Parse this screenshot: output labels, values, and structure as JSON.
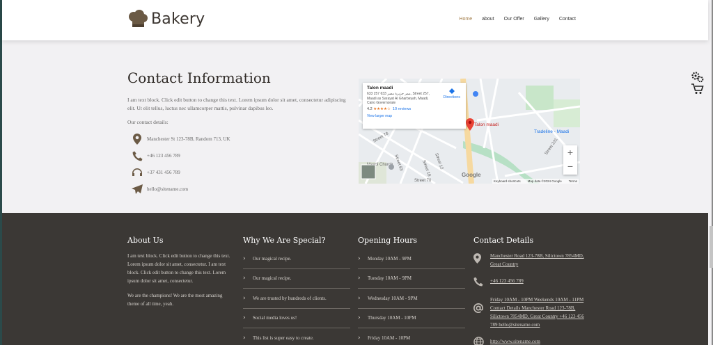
{
  "header": {
    "logo_text": "Bakery",
    "nav": [
      {
        "label": "Home",
        "active": true
      },
      {
        "label": "about",
        "active": false
      },
      {
        "label": "Our Offer",
        "active": false
      },
      {
        "label": "Gallery",
        "active": false
      },
      {
        "label": "Contact",
        "active": false
      }
    ]
  },
  "contact": {
    "title": "Contact Information",
    "intro": "I am text block. Click edit button to change this text. Lorem ipsum dolor sit amet, consectetur adipiscing elit. Ut elit tellus, luctus nec ullamcorper mattis, pulvinar dapibus leo.",
    "details_label": "Our contact details:",
    "details": [
      {
        "icon": "map-marker-icon",
        "text": "Manchester St 123-78B, Random 713, UK"
      },
      {
        "icon": "phone-icon",
        "text": "+46 123 456 789"
      },
      {
        "icon": "headphones-icon",
        "text": "+37 431 456 789"
      },
      {
        "icon": "paper-plane-icon",
        "text": "hello@sitename.com"
      }
    ]
  },
  "map": {
    "place_name": "Talon maadi",
    "address": "633 257 633 ممر جزيرة مصر, Street 257, Maadi as Sarayat Al Gharbeyah, Maadi, Cairo Governorate",
    "rating": "4.2",
    "stars": "★★★★☆",
    "reviews": "10 reviews",
    "directions": "Directions",
    "larger_map": "View larger map",
    "pin_label": "Talon maadi",
    "poi_label": "Tradeline - Maadi",
    "street_labels": [
      "Street 78",
      "Street 83",
      "Street 18",
      "Street 12",
      "Street 70",
      "Street 231"
    ],
    "church_label": "Maadi Church",
    "google": "Google",
    "footer_links": [
      "Keyboard shortcuts",
      "Map data ©2024 Google",
      "Terms"
    ],
    "zoom_in": "+",
    "zoom_out": "−"
  },
  "footer": {
    "about": {
      "title": "About Us",
      "p1": "I am text block. Click edit button to change this text. Lorem ipsum dolor sit amet, consectetur. I am text block. Click edit button to change this text. Lorem ipsum dolor sit amet, consectetur.",
      "p2": "We are the champions! We are the most amazing theme of all time, yeah."
    },
    "special": {
      "title": "Why We Are Special?",
      "items": [
        "Our magical recipe.",
        "Our magical recipe.",
        "We are trusted by hundreds of clients.",
        "Social media loves us!",
        "This list is super easy to create."
      ]
    },
    "hours": {
      "title": "Opening Hours",
      "items": [
        "Monday 10AM - 9PM",
        "Tuesday 10AM - 9PM",
        "Wednesday 10AM - 9PM",
        "Thursday 10AM - 10PM",
        "Friday 10AM - 10PM"
      ]
    },
    "contact": {
      "title": "Contact Details",
      "items": [
        {
          "icon": "map-marker-icon",
          "text": "Manchester Road 123-78B, Silictown 7854MD, Great Country"
        },
        {
          "icon": "phone-icon",
          "text": "+46 123 456 789"
        },
        {
          "icon": "at-sign-icon",
          "text": "Friday 10AM - 10PM Weekends 10AM - 11PM Contact Details Manchester Road 123-78B, Silictown 7854MD, Great Country +46 123 456 789 hello@sitename.com"
        },
        {
          "icon": "globe-icon",
          "text": "http://www.sitename.com"
        }
      ]
    }
  },
  "colors": {
    "accent": "#a07a45",
    "footer_bg": "#3b3835",
    "page_bg": "#f2f1f3",
    "heading": "#2f2a26"
  }
}
